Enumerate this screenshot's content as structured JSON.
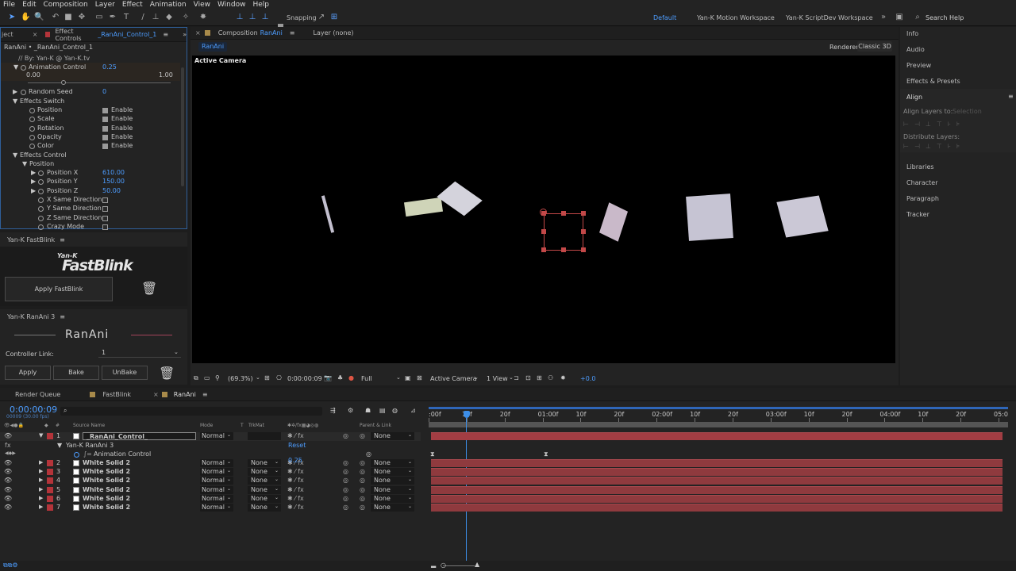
{
  "menubar": [
    "File",
    "Edit",
    "Composition",
    "Layer",
    "Effect",
    "Animation",
    "View",
    "Window",
    "Help"
  ],
  "toolbar": {
    "snapping": "Snapping",
    "workspaces": [
      "Default",
      "Yan-K Motion Workspace",
      "Yan-K ScriptDev Workspace"
    ],
    "search_placeholder": "Search Help"
  },
  "effect_controls": {
    "tab_left": "ject",
    "tab_title": "Effect Controls",
    "tab_layer": "_RanAni_Control_1",
    "breadcrumb": "RanAni • _RanAni_Control_1",
    "by_line": "// By: Yan-K @ Yan-K.tv",
    "animation_control": {
      "label": "Animation Control",
      "value": "0.25",
      "min": "0.00",
      "max": "1.00",
      "fraction": 0.25
    },
    "random_seed": {
      "label": "Random Seed",
      "value": "0"
    },
    "effects_switch": "Effects Switch",
    "switches": [
      {
        "label": "Position",
        "check": "Enable"
      },
      {
        "label": "Scale",
        "check": "Enable"
      },
      {
        "label": "Rotation",
        "check": "Enable"
      },
      {
        "label": "Opacity",
        "check": "Enable"
      },
      {
        "label": "Color",
        "check": "Enable"
      }
    ],
    "effects_control": "Effects Control",
    "position": "Position",
    "positions": [
      {
        "label": "Position X",
        "value": "610.00"
      },
      {
        "label": "Position Y",
        "value": "150.00"
      },
      {
        "label": "Position Z",
        "value": "50.00"
      }
    ],
    "options": [
      "X Same Direction",
      "Y Same Direction",
      "Z Same Direction",
      "Crazy Mode"
    ]
  },
  "fastblink": {
    "title": "Yan-K FastBlink",
    "logo_top": "Yan-K",
    "logo": "FastBlink",
    "apply": "Apply FastBlink"
  },
  "ranani": {
    "title": "Yan-K RanAni 3",
    "logo": "RanAni",
    "controller_label": "Controller Link:",
    "controller_value": "1",
    "apply": "Apply",
    "bake": "Bake",
    "unbake": "UnBake"
  },
  "composition": {
    "tab_title": "Composition",
    "tab_name": "RanAni",
    "layer_tab": "Layer (none)",
    "crumb": "RanAni",
    "renderer_label": "Renderer:",
    "renderer_value": "Classic 3D",
    "camera_label": "Active Camera",
    "footer": {
      "zoom": "(69.3%)",
      "timecode": "0:00:00:09",
      "resolution": "Full",
      "camera": "Active Camera",
      "view": "1 View",
      "exposure": "+0.0"
    }
  },
  "right_panel": {
    "items_top": [
      "Info",
      "Audio",
      "Preview",
      "Effects & Presets"
    ],
    "align_title": "Align",
    "align_to_label": "Align Layers to:",
    "align_to_value": "Selection",
    "distribute_label": "Distribute Layers:",
    "items_bottom": [
      "Libraries",
      "Character",
      "Paragraph",
      "Tracker"
    ]
  },
  "timeline": {
    "tabs": [
      "Render Queue",
      "FastBlink",
      "RanAni"
    ],
    "timecode": "0:00:00:09",
    "fps": "00009 (30.00 fps)",
    "columns": {
      "source": "Source Name",
      "mode": "Mode",
      "t": "T",
      "trkmat": "TrkMat",
      "parent": "Parent & Link"
    },
    "ruler": [
      ":00f",
      "10f",
      "20f",
      "01:00f",
      "10f",
      "20f",
      "02:00f",
      "10f",
      "20f",
      "03:00f",
      "10f",
      "20f",
      "04:00f",
      "10f",
      "20f",
      "05:0"
    ],
    "layers": [
      {
        "num": "1",
        "name": "_RanAni_Control_",
        "mode": "Normal",
        "trkmat": "",
        "parent": "None"
      },
      {
        "num": "2",
        "name": "White Solid 2",
        "mode": "Normal",
        "trkmat": "None",
        "parent": "None"
      },
      {
        "num": "3",
        "name": "White Solid 2",
        "mode": "Normal",
        "trkmat": "None",
        "parent": "None"
      },
      {
        "num": "4",
        "name": "White Solid 2",
        "mode": "Normal",
        "trkmat": "None",
        "parent": "None"
      },
      {
        "num": "5",
        "name": "White Solid 2",
        "mode": "Normal",
        "trkmat": "None",
        "parent": "None"
      },
      {
        "num": "6",
        "name": "White Solid 2",
        "mode": "Normal",
        "trkmat": "None",
        "parent": "None"
      },
      {
        "num": "7",
        "name": "White Solid 2",
        "mode": "Normal",
        "trkmat": "None",
        "parent": "None"
      }
    ],
    "effect_name": "Yan-K RanAni 3",
    "reset": "Reset",
    "anim_prop": "Animation Control",
    "anim_value": "0.25"
  },
  "colors": {
    "accent": "#4d9dff",
    "layer_bar": "#8f3a3e",
    "label_red": "#b4343a",
    "bg": "#1d1d1d",
    "panel": "#232323"
  }
}
